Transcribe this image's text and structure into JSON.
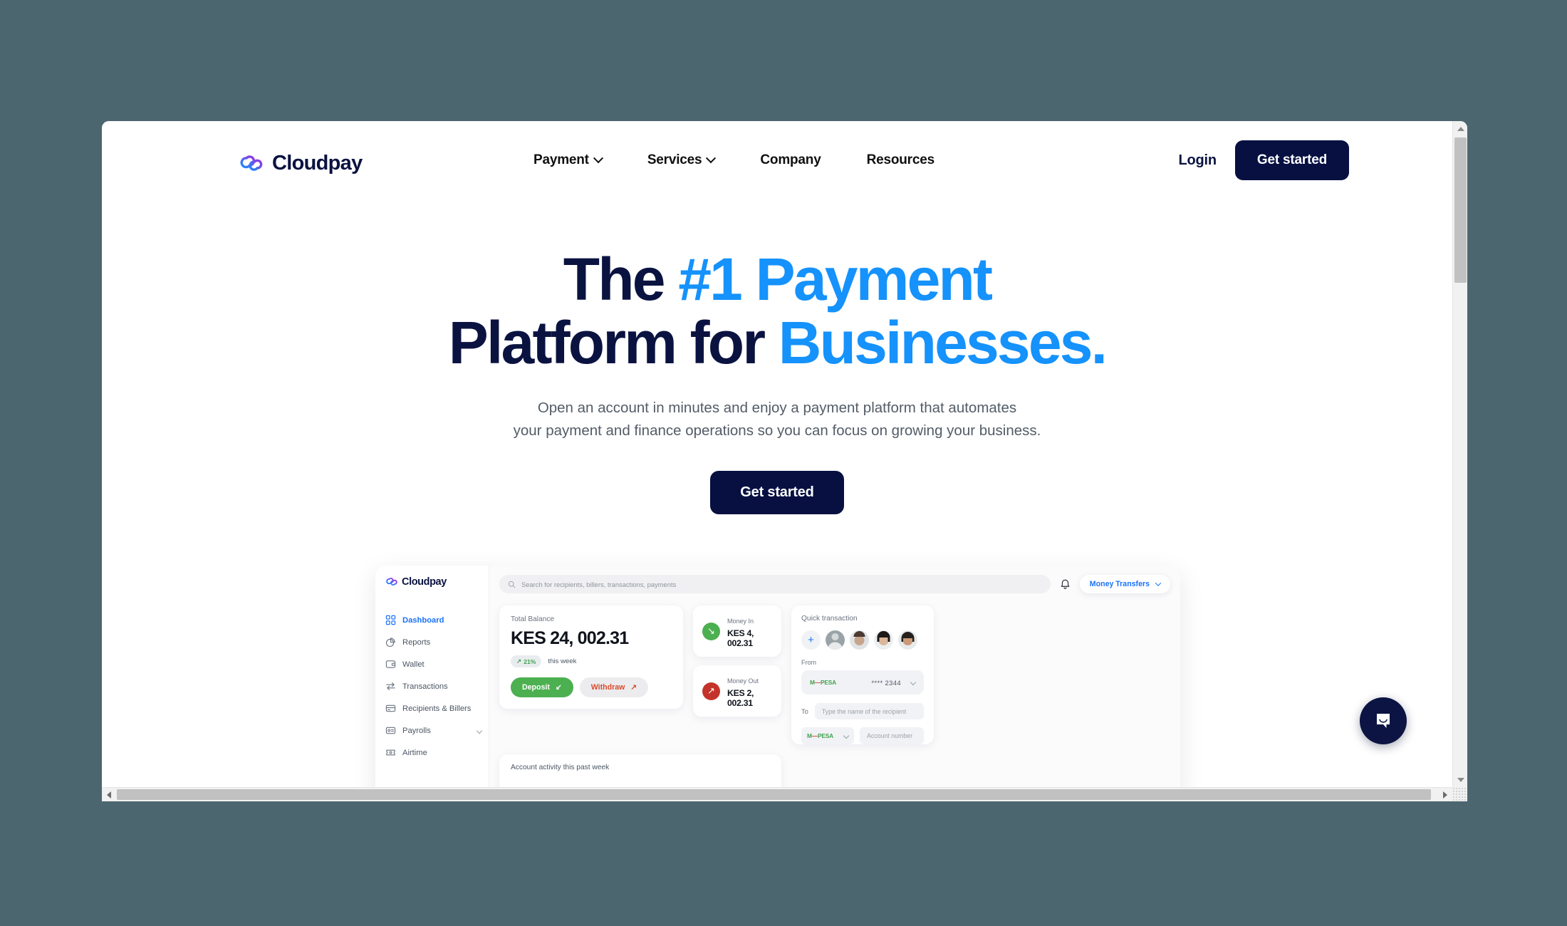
{
  "site": {
    "brand": "Cloudpay",
    "accent_blue": "#1592fb",
    "navy": "#071041",
    "page_bg": "#4c6670"
  },
  "nav": {
    "links": [
      {
        "label": "Payment",
        "has_chevron": true
      },
      {
        "label": "Services",
        "has_chevron": true
      },
      {
        "label": "Company",
        "has_chevron": false
      },
      {
        "label": "Resources",
        "has_chevron": false
      }
    ],
    "login_label": "Login",
    "cta_label": "Get started"
  },
  "hero": {
    "headline_line1_a": "The ",
    "headline_line1_b": "#1 Payment",
    "headline_line2_a": "Platform for ",
    "headline_line2_b": "Businesses.",
    "subheadline_line1": "Open an account in minutes and enjoy a payment platform that automates",
    "subheadline_line2": "your payment and finance operations so you can focus on growing your business.",
    "cta_label": "Get started"
  },
  "dashboard": {
    "brand": "Cloudpay",
    "sidebar": [
      {
        "label": "Dashboard",
        "icon": "grid-icon",
        "active": true,
        "chevron": false
      },
      {
        "label": "Reports",
        "icon": "pie-chart-icon",
        "active": false,
        "chevron": false
      },
      {
        "label": "Wallet",
        "icon": "wallet-icon",
        "active": false,
        "chevron": false
      },
      {
        "label": "Transactions",
        "icon": "transfer-arrows-icon",
        "active": false,
        "chevron": false
      },
      {
        "label": "Recipients & Billers",
        "icon": "card-icon",
        "active": false,
        "chevron": false
      },
      {
        "label": "Payrolls",
        "icon": "id-card-icon",
        "active": false,
        "chevron": true
      },
      {
        "label": "Airtime",
        "icon": "ticket-icon",
        "active": false,
        "chevron": false
      }
    ],
    "search_placeholder": "Search for recipients, billers, transactions, payments",
    "money_transfers_label": "Money Transfers",
    "balance": {
      "label": "Total Balance",
      "amount": "KES 24, 002.31",
      "trend_value": "21%",
      "trend_period": "this week",
      "deposit_label": "Deposit",
      "withdraw_label": "Withdraw"
    },
    "money_in": {
      "label": "Money In",
      "amount": "KES 4, 002.31"
    },
    "money_out": {
      "label": "Money Out",
      "amount": "KES 2, 002.31"
    },
    "quick": {
      "title": "Quick transaction",
      "from_label": "From",
      "from_provider_a": "M",
      "from_provider_dash": "—",
      "from_provider_b": "PESA",
      "from_masked": "**** 2344",
      "to_label": "To",
      "to_placeholder": "Type the name of the recipient",
      "account_placeholder": "Account number"
    },
    "activity_title": "Account activity this past week"
  }
}
